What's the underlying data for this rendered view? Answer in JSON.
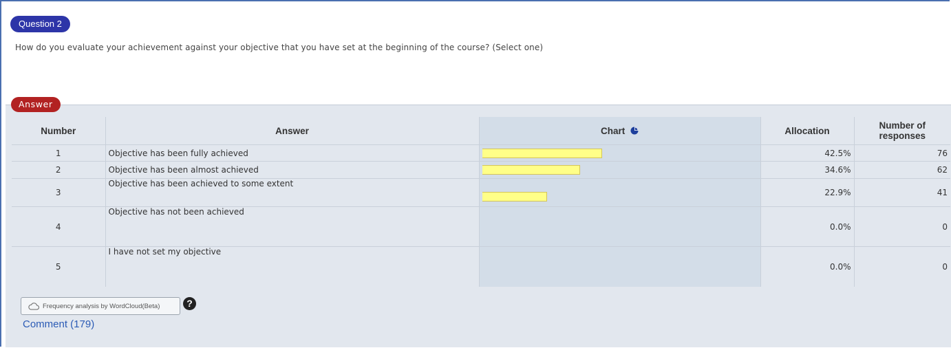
{
  "question": {
    "badge": "Question 2",
    "text": "How do you evaluate your achievement against your objective that you have set at the beginning of the course? (Select one)"
  },
  "answer_section": {
    "badge": "Answer",
    "headers": {
      "number": "Number",
      "answer": "Answer",
      "chart": "Chart",
      "allocation": "Allocation",
      "responses_line1": "Number of",
      "responses_line2": "responses"
    },
    "chart_icon": "pie-chart-icon",
    "rows": [
      {
        "number": "1",
        "answer": "Objective has been fully achieved",
        "allocation": "42.5%",
        "responses": "76",
        "fraction": 0.425
      },
      {
        "number": "2",
        "answer": "Objective has been almost achieved",
        "allocation": "34.6%",
        "responses": "62",
        "fraction": 0.346
      },
      {
        "number": "3",
        "answer": "Objective has been achieved to some extent",
        "allocation": "22.9%",
        "responses": "41",
        "fraction": 0.229
      },
      {
        "number": "4",
        "answer": "Objective has not been achieved",
        "allocation": "0.0%",
        "responses": "0",
        "fraction": 0.0
      },
      {
        "number": "5",
        "answer": "I have not set my objective",
        "allocation": "0.0%",
        "responses": "0",
        "fraction": 0.0
      }
    ]
  },
  "wordcloud_button": {
    "label": "Frequency analysis by WordCloud(Beta)",
    "icon": "cloud-icon"
  },
  "help_icon": "question-circle-icon",
  "comment_link": "Comment (179)",
  "colors": {
    "question_badge": "#2d35a8",
    "answer_badge": "#b22222",
    "bar_fill": "#ffff88",
    "link": "#2b5bb5",
    "panel": "#e2e7ee",
    "chart_column": "#d3dde8"
  }
}
